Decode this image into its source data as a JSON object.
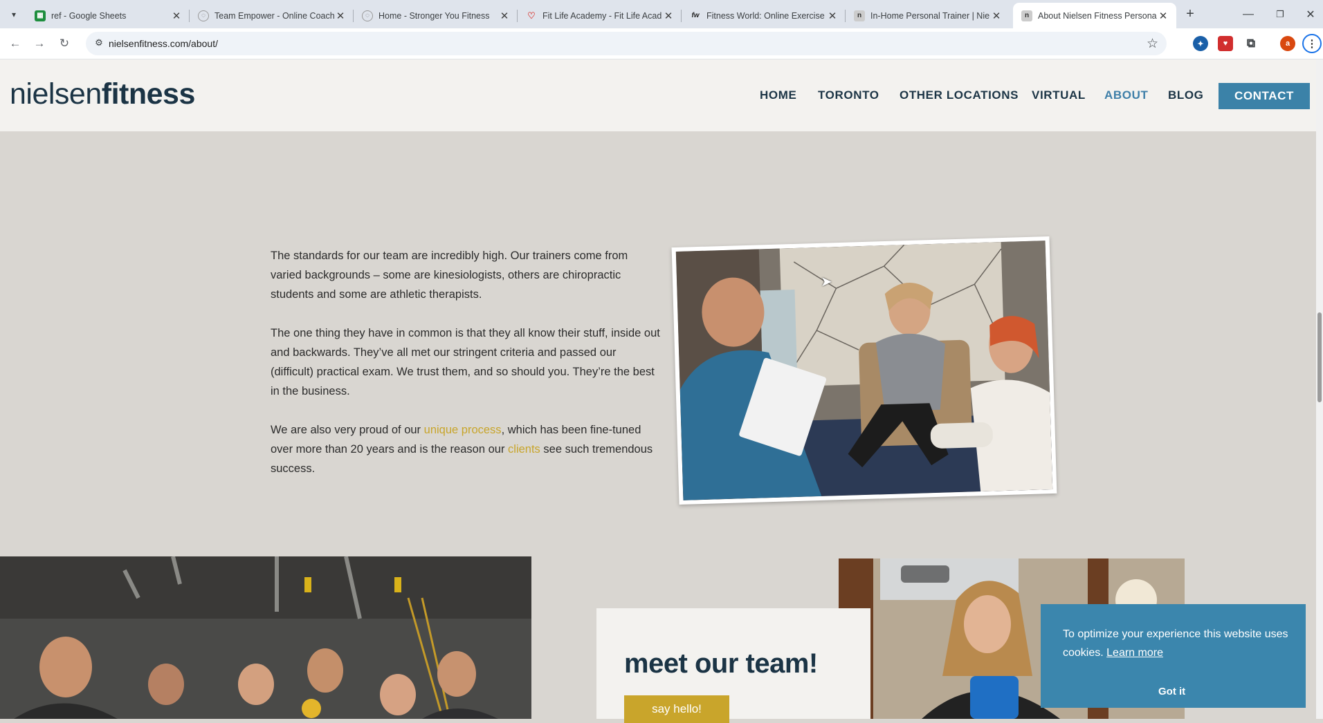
{
  "browser": {
    "tabs": [
      {
        "title": "ref - Google Sheets",
        "favicon": "sheets-icon"
      },
      {
        "title": "Team Empower - Online Coachi",
        "favicon": "globe-icon"
      },
      {
        "title": "Home - Stronger You Fitness",
        "favicon": "globe-icon"
      },
      {
        "title": "Fit Life Academy - Fit Life Acad",
        "favicon": "heart-icon"
      },
      {
        "title": "Fitness World: Online Exercise C",
        "favicon": "fw-icon"
      },
      {
        "title": "In-Home Personal Trainer | Niel",
        "favicon": "nielsen-icon"
      },
      {
        "title": "About Nielsen Fitness Personal",
        "favicon": "nielsen-icon"
      }
    ],
    "url": "nielsenfitness.com/about/",
    "profile_initial": "a"
  },
  "site": {
    "logo_light": "nielsen",
    "logo_bold": "fitness",
    "nav": [
      "HOME",
      "TORONTO",
      "OTHER LOCATIONS",
      "VIRTUAL",
      "ABOUT",
      "BLOG"
    ],
    "contact_label": "CONTACT",
    "accent": "#3b82a8",
    "gold": "#c9a52b"
  },
  "content": {
    "p1": "The standards for our team are incredibly high. Our trainers come from varied backgrounds – some are kinesiologists, others are chiropractic students and some are athletic therapists.",
    "p2": "The one thing they have in common is that they all know their stuff, inside out and backwards. They’ve all met our stringent criteria and passed our (difficult) practical exam. We trust them, and so should you. They’re the best in the business.",
    "p3_a": "We are also very proud of our ",
    "p3_link1": "unique process",
    "p3_b": ", which has been fine-tuned over more than 20 years and is the reason our ",
    "p3_link2": "clients",
    "p3_c": " see such tremendous success."
  },
  "team_card": {
    "heading": "meet our team!",
    "button": "say hello!"
  },
  "cookie": {
    "message": "To optimize your experience this website uses cookies.",
    "learn_more": "Learn more",
    "accept": "Got it"
  }
}
